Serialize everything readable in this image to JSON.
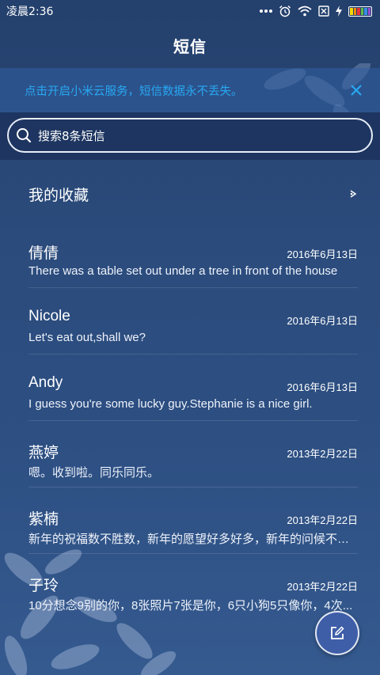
{
  "status_bar": {
    "time": "凌晨2:36",
    "icons": [
      "more-dots-icon",
      "alarm-icon",
      "wifi-icon",
      "no-sim-icon",
      "charging-icon",
      "battery-icon"
    ]
  },
  "header": {
    "title": "短信"
  },
  "cloud_banner": {
    "text": "点击开启小米云服务，短信数据永不丢失。",
    "close_icon": "close-icon"
  },
  "search": {
    "placeholder": "搜索8条短信",
    "icon": "search-icon"
  },
  "favorites": {
    "label": "我的收藏",
    "icon": "chevron-right-icon"
  },
  "conversations": [
    {
      "name": "倩倩",
      "date": "2016年6月13日",
      "preview": "There was a table set out under a tree in front of the house"
    },
    {
      "name": "Nicole",
      "date": "2016年6月13日",
      "preview": "Let's eat out,shall we?"
    },
    {
      "name": "Andy",
      "date": "2016年6月13日",
      "preview": "I guess you're some lucky guy.Stephanie is a nice girl."
    },
    {
      "name": "燕婷",
      "date": "2013年2月22日",
      "preview": "嗯。收到啦。同乐同乐。"
    },
    {
      "name": "紫楠",
      "date": "2013年2月22日",
      "preview": "新年的祝福数不胜数，新年的愿望好多好多，新年的问候不能少"
    },
    {
      "name": "子玲",
      "date": "2013年2月22日",
      "preview": "10分想念9别的你，8张照片7张是你，6只小狗5只像你，4次..."
    }
  ],
  "fab": {
    "icon": "compose-icon"
  },
  "colors": {
    "accent": "#27a8f2",
    "background": "#2b4b7c",
    "search_bg": "#1d3560",
    "fab": "#3e5ea8"
  }
}
